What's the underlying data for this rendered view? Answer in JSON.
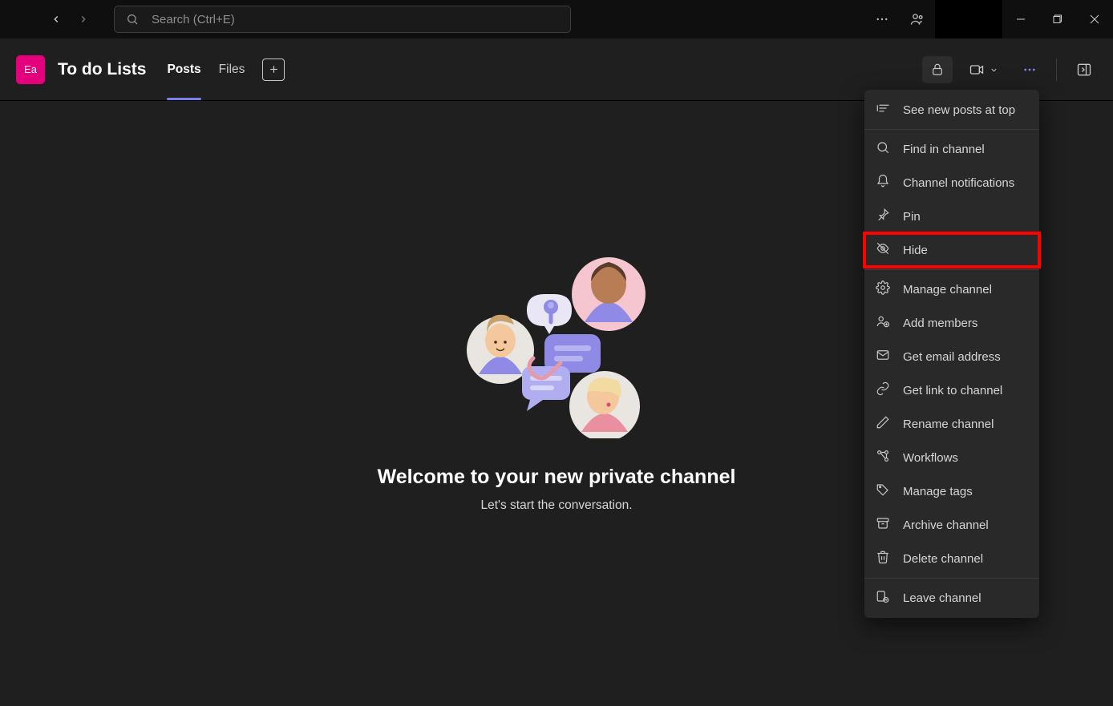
{
  "titlebar": {
    "search_placeholder": "Search (Ctrl+E)"
  },
  "header": {
    "team_initials": "Ea",
    "channel_name": "To do Lists",
    "tabs": [
      {
        "label": "Posts",
        "active": true
      },
      {
        "label": "Files",
        "active": false
      }
    ]
  },
  "content": {
    "headline": "Welcome to your new private channel",
    "subline": "Let's start the conversation."
  },
  "menu": {
    "items": [
      {
        "icon": "sort-icon",
        "label": "See new posts at top"
      },
      {
        "sep": true
      },
      {
        "icon": "search-icon",
        "label": "Find in channel"
      },
      {
        "icon": "bell-icon",
        "label": "Channel notifications"
      },
      {
        "icon": "pin-icon",
        "label": "Pin"
      },
      {
        "icon": "hide-icon",
        "label": "Hide",
        "highlight": true
      },
      {
        "sep": true
      },
      {
        "icon": "gear-icon",
        "label": "Manage channel"
      },
      {
        "icon": "add-member-icon",
        "label": "Add members"
      },
      {
        "icon": "mail-icon",
        "label": "Get email address"
      },
      {
        "icon": "link-icon",
        "label": "Get link to channel"
      },
      {
        "icon": "pencil-icon",
        "label": "Rename channel"
      },
      {
        "icon": "workflow-icon",
        "label": "Workflows"
      },
      {
        "icon": "tag-icon",
        "label": "Manage tags"
      },
      {
        "icon": "archive-icon",
        "label": "Archive channel"
      },
      {
        "icon": "trash-icon",
        "label": "Delete channel"
      },
      {
        "sep": true
      },
      {
        "icon": "leave-icon",
        "label": "Leave channel"
      }
    ]
  }
}
